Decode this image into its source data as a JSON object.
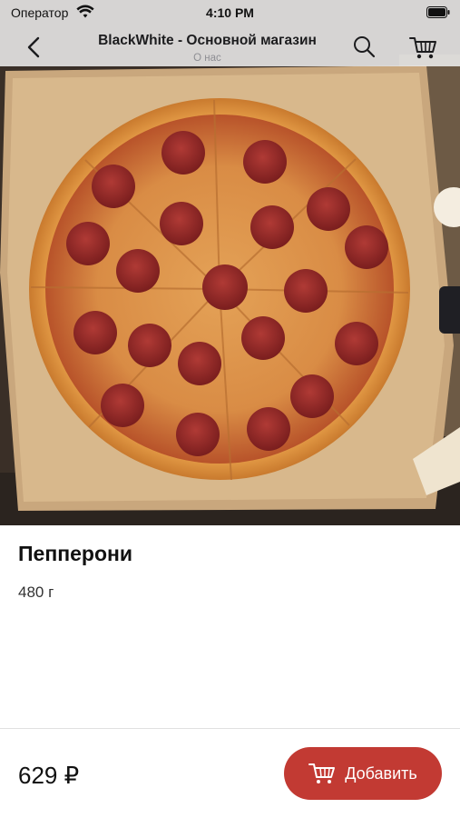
{
  "status_bar": {
    "carrier": "Оператор",
    "time": "4:10 PM"
  },
  "nav": {
    "title": "BlackWhite - Основной магазин",
    "subtitle": "О нас",
    "icons": [
      "chevron-left-icon",
      "search-icon",
      "cart-icon"
    ]
  },
  "product": {
    "name": "Пепперони",
    "weight": "480 г",
    "price": "629 ₽",
    "image": "pepperoni-pizza-photo"
  },
  "actions": {
    "add_label": "Добавить"
  },
  "colors": {
    "accent": "#c23a33",
    "navbar": "#ececec"
  }
}
